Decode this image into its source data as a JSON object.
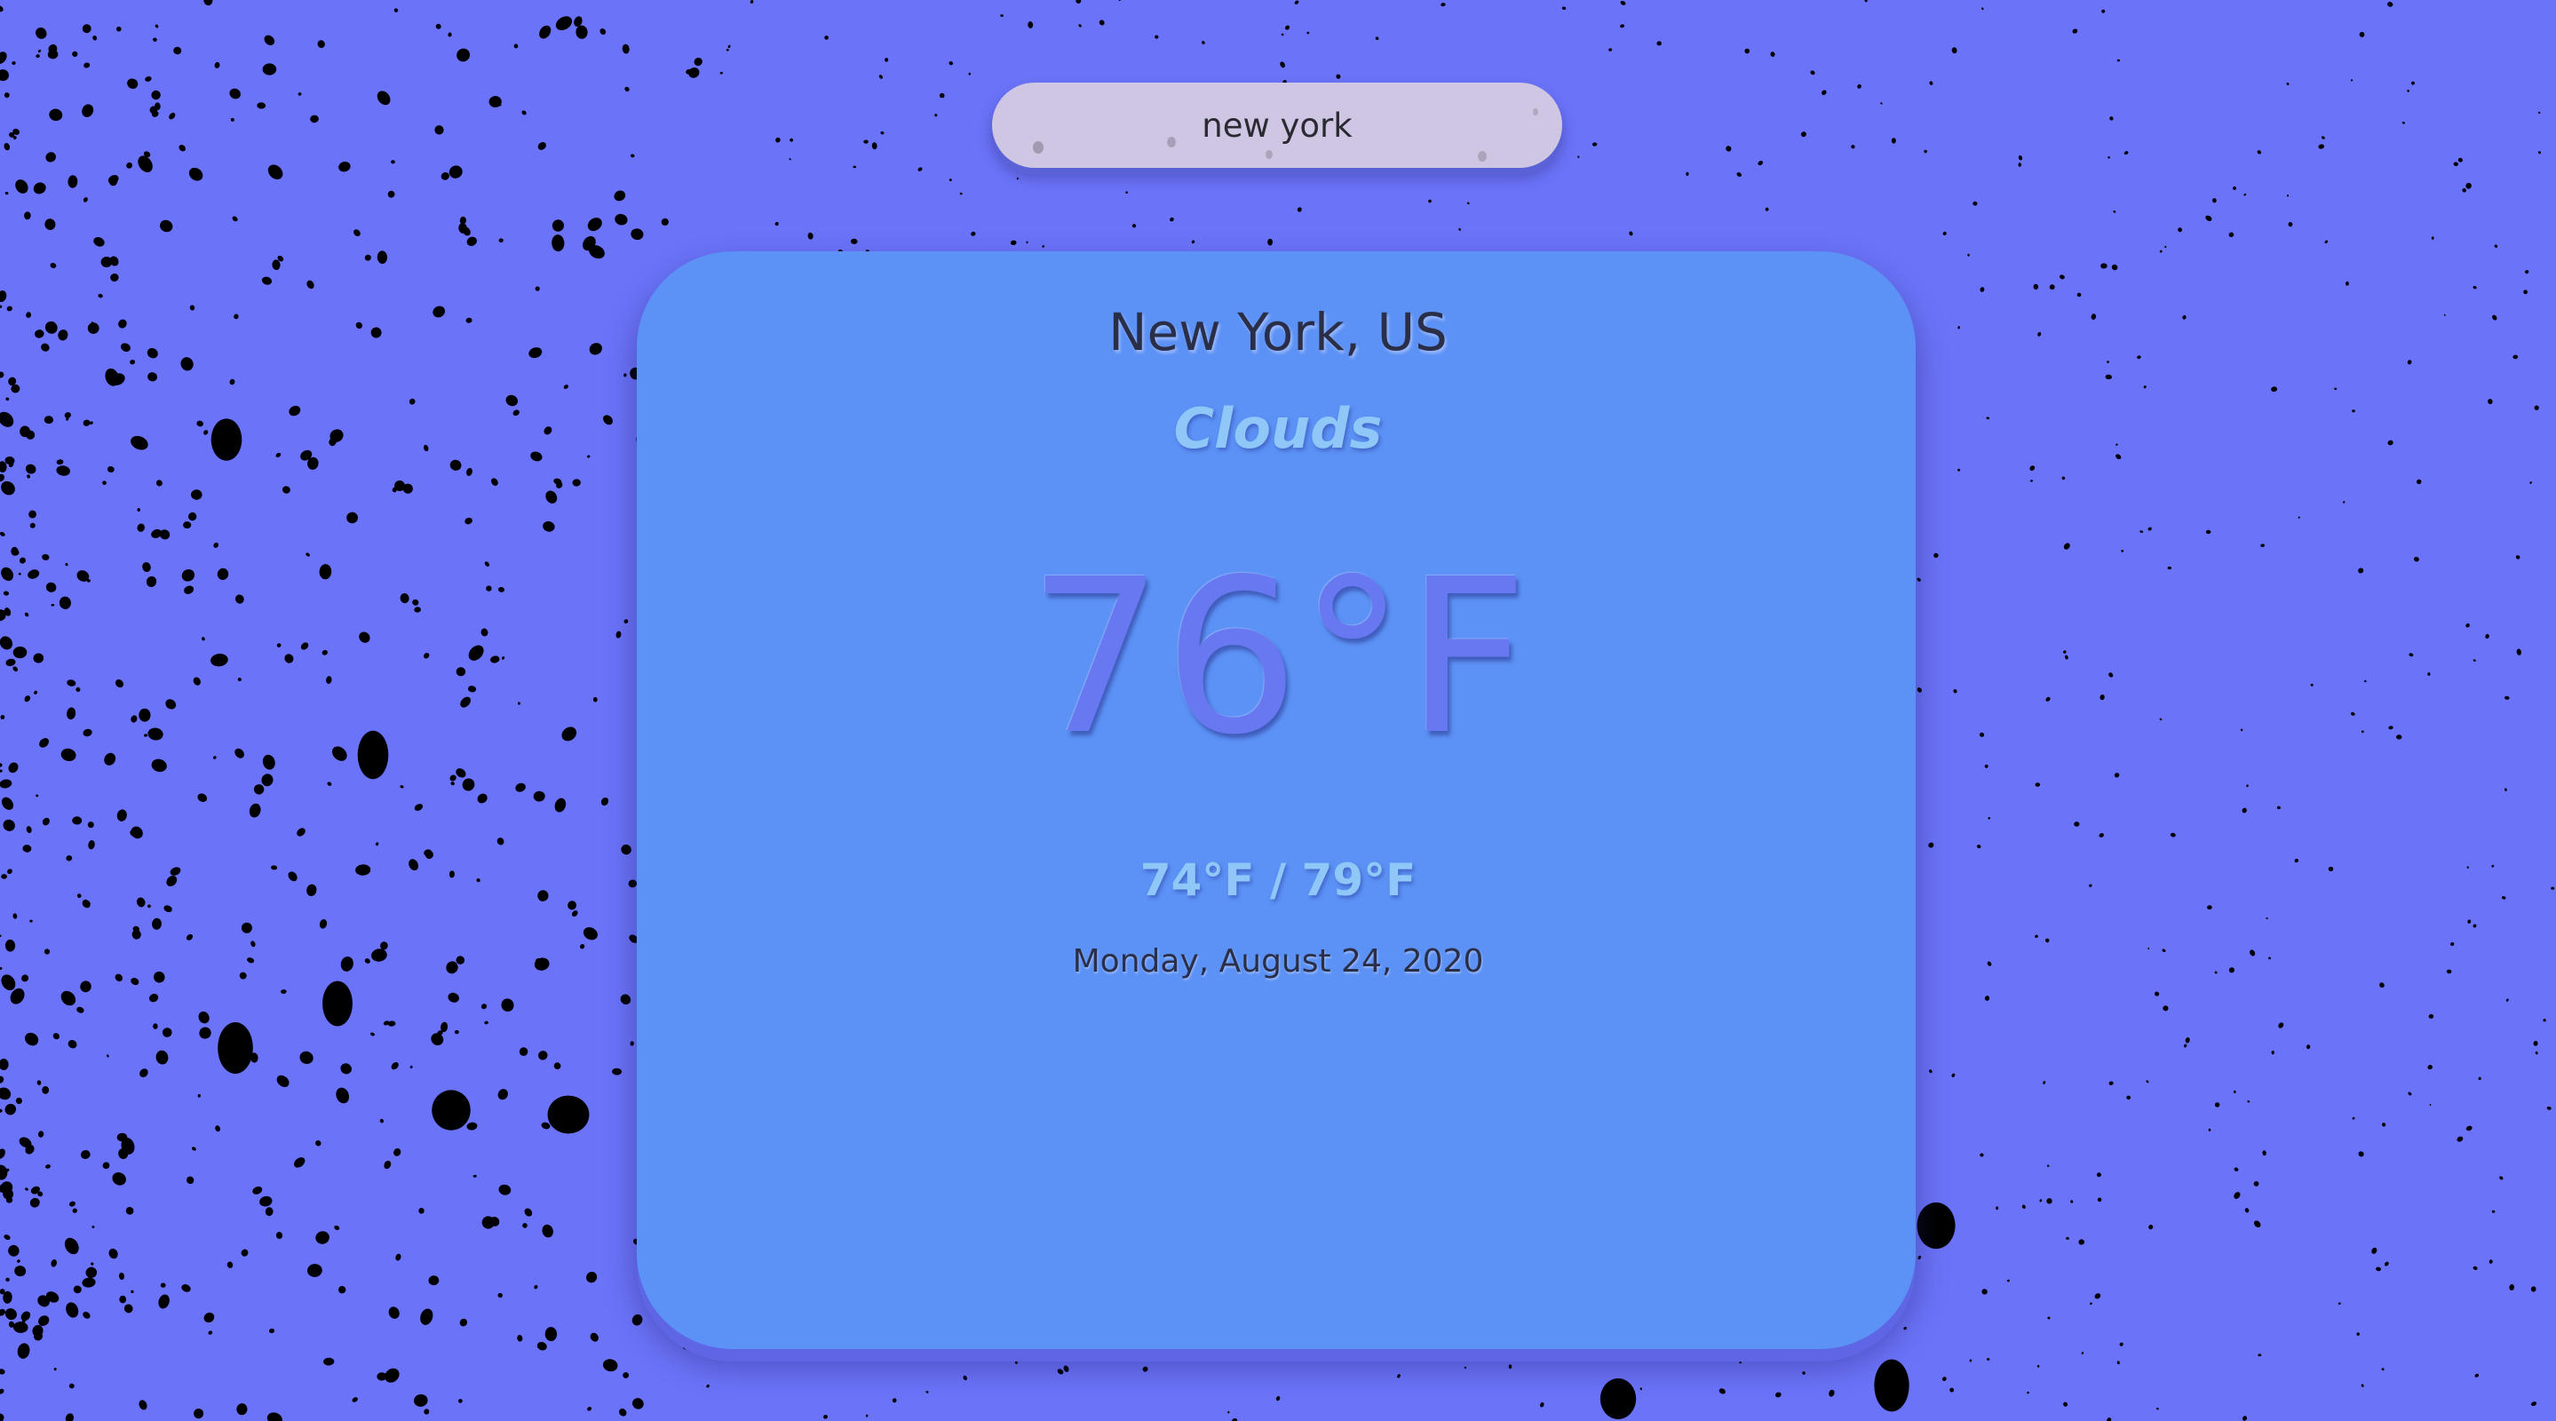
{
  "background": {
    "color": "#6b73f8",
    "speckle_color": "#000000"
  },
  "search": {
    "value": "new york",
    "background": "#cfc6e3"
  },
  "weather": {
    "location": "New York, US",
    "condition": "Clouds",
    "temperature": "76°F",
    "range": "74°F / 79°F",
    "date": "Monday, August 24, 2020",
    "card_color": "#5c92f5",
    "accent_color": "#8fc8f8"
  }
}
